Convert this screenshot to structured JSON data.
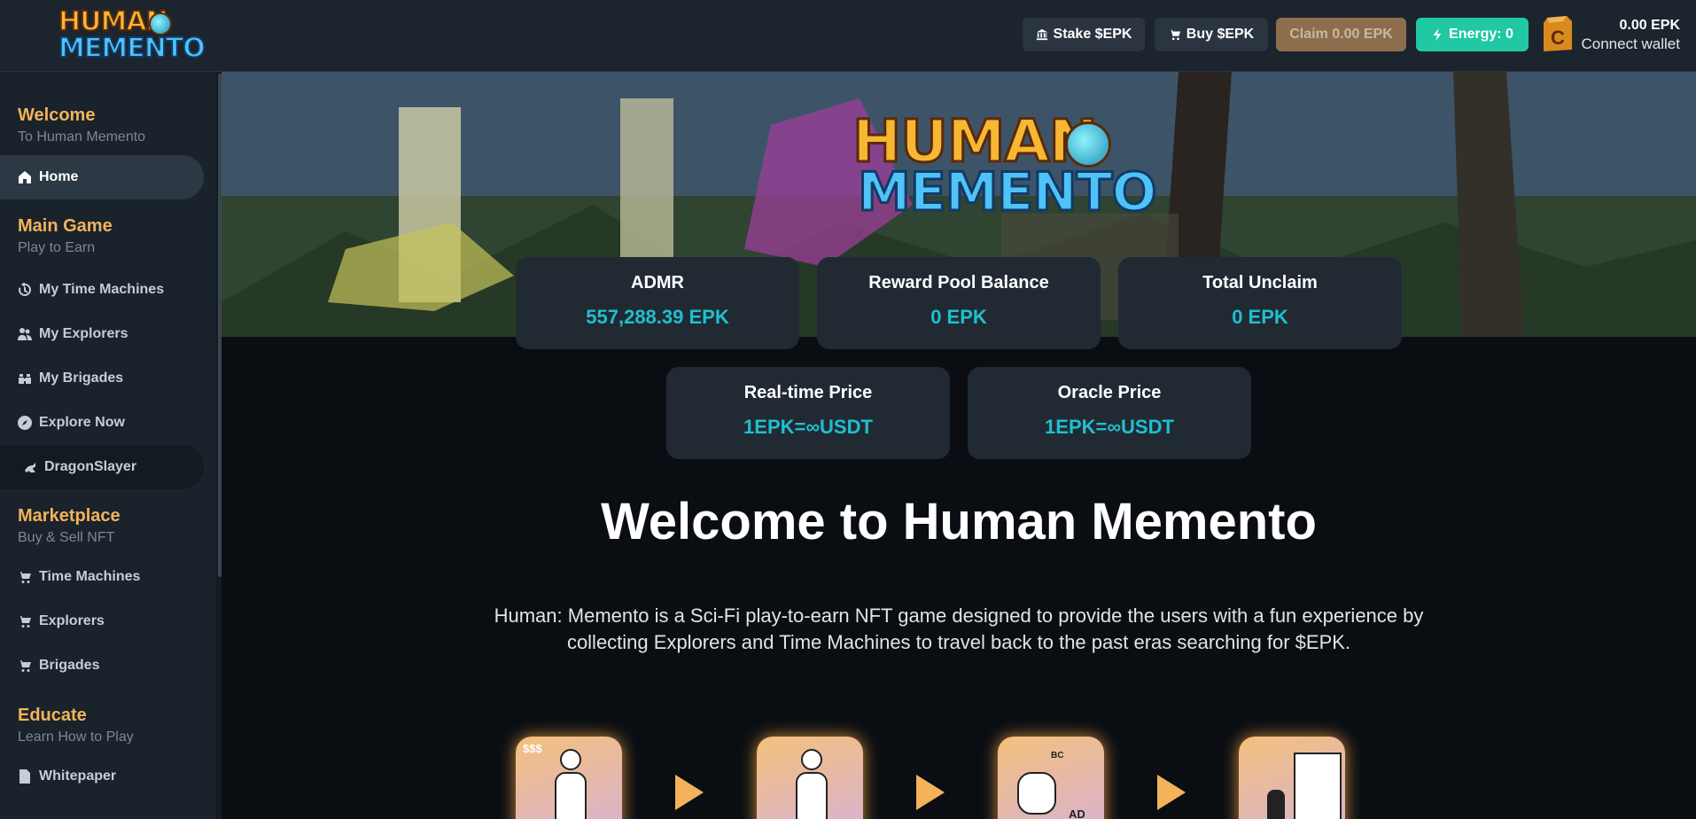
{
  "header": {
    "logo_line1": "HUMAN",
    "logo_line2": "MEMENTO",
    "stake_label": "Stake $EPK",
    "buy_label": "Buy $EPK",
    "claim_label": "Claim 0.00 EPK",
    "energy_label": "Energy: 0",
    "wallet_balance": "0.00 EPK",
    "connect_label": "Connect wallet"
  },
  "sidebar": {
    "welcome": {
      "title": "Welcome",
      "subtitle": "To Human Memento"
    },
    "home": "Home",
    "main_game": {
      "title": "Main Game",
      "subtitle": "Play to Earn"
    },
    "game_items": [
      "My Time Machines",
      "My Explorers",
      "My Brigades",
      "Explore Now",
      "DragonSlayer"
    ],
    "marketplace": {
      "title": "Marketplace",
      "subtitle": "Buy & Sell NFT"
    },
    "market_items": [
      "Time Machines",
      "Explorers",
      "Brigades"
    ],
    "educate": {
      "title": "Educate",
      "subtitle": "Learn How to Play"
    },
    "educate_items": [
      "Whitepaper"
    ]
  },
  "banner": {
    "logo_line1": "HUMAN",
    "logo_line2": "MEMENTO"
  },
  "stats": [
    {
      "label": "ADMR",
      "value": "557,288.39 EPK"
    },
    {
      "label": "Reward Pool Balance",
      "value": "0 EPK"
    },
    {
      "label": "Total Unclaim",
      "value": "0 EPK"
    },
    {
      "label": "Real-time Price",
      "value": "1EPK=∞USDT"
    },
    {
      "label": "Oracle Price",
      "value": "1EPK=∞USDT"
    }
  ],
  "main": {
    "title": "Welcome to Human Memento",
    "description": "Human: Memento is a Sci-Fi play-to-earn NFT game designed to provide the users with a fun experience by collecting Explorers and Time Machines to travel back to the past eras searching for $EPK.",
    "step1_text": "$$$",
    "step3_text1": "BC",
    "step3_text2": "AD"
  },
  "colors": {
    "accent": "#1ec0cf",
    "section_title": "#f2b35a",
    "energy": "#20c9a3"
  }
}
